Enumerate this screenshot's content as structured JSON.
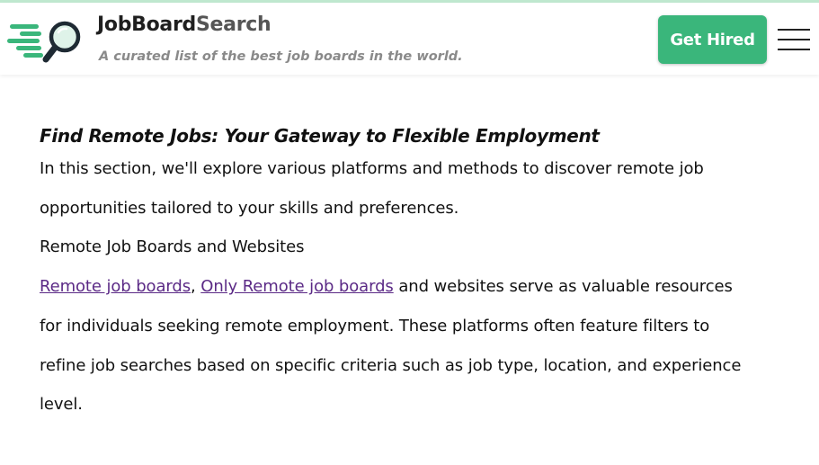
{
  "header": {
    "brand_part1": "JobBoard",
    "brand_part2": "Search",
    "tagline": "A curated list of the best job boards in the world.",
    "cta_label": "Get Hired"
  },
  "article": {
    "heading": "Find Remote Jobs: Your Gateway to Flexible Employment",
    "intro": "In this section, we'll explore various platforms and methods to discover remote job opportunities tailored to your skills and preferences.",
    "subheading": "Remote Job Boards and Websites",
    "link1": "Remote job boards",
    "separator": ", ",
    "link2": "Only Remote job boards",
    "body_rest": " and websites serve as valuable resources for individuals seeking remote employment. These platforms often feature filters to refine job searches based on specific criteria such as job type, location, and experience level."
  },
  "colors": {
    "brand_green": "#3ab67b",
    "link": "#5b2a86",
    "text": "#111111"
  },
  "icons": {
    "logo": "magnifier-with-speed-lines",
    "menu": "hamburger-menu-icon"
  }
}
